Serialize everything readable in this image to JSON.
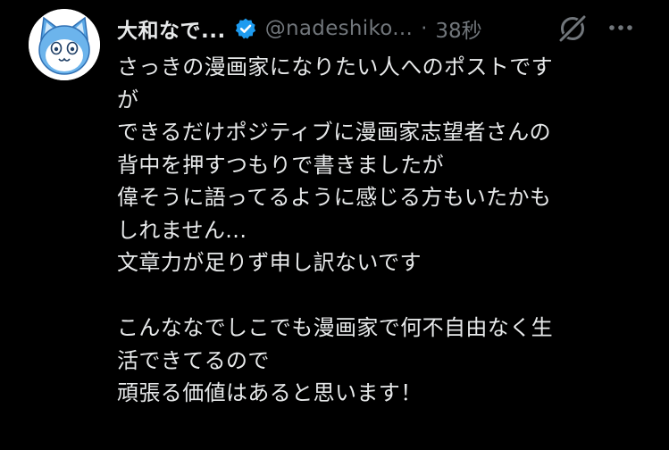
{
  "post": {
    "display_name": "大和なで...",
    "handle": "@nadeshiko...",
    "separator": "·",
    "time": "38秒",
    "verified_color": "#1d9bf0",
    "avatar_icon": "cat-mascot-avatar",
    "lines": [
      "さっきの漫画家になりたい人へのポストです",
      "が",
      "できるだけポジティブに漫画家志望者さんの",
      "背中を押すつもりで書きましたが",
      "偉そうに語ってるように感じる方もいたかも",
      "しれません...",
      "文章力が足りず申し訳ないです",
      "",
      "こんななでしこでも漫画家で何不自由なく生",
      "活できてるので",
      "頑張る価値はあると思います！"
    ]
  },
  "icons": {
    "grok": "grok-icon",
    "more": "more-options-icon",
    "verified": "verified-badge-icon"
  },
  "colors": {
    "background": "#000000",
    "text_primary": "#e7e9ea",
    "text_secondary": "#71767b",
    "accent": "#1d9bf0"
  }
}
